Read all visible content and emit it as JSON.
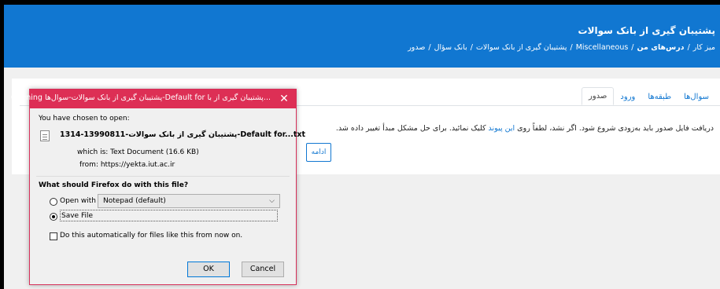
{
  "header": {
    "title": "پشتیبان گیری از بانک سوالات",
    "breadcrumb": [
      "میز کار",
      "درس‌های من",
      "Miscellaneous",
      "پشتیبان گیری از بانک سوالات",
      "بانک سؤال",
      "صدور"
    ]
  },
  "tabs": [
    {
      "label": "سوال‌ها"
    },
    {
      "label": "طبقه‌ها"
    },
    {
      "label": "ورود"
    },
    {
      "label": "صدور"
    }
  ],
  "message": {
    "before": "دریافت فایل صدور باید به‌زودی شروع شود. اگر نشد، لطفاً روی",
    "link": "این پیوند",
    "after": "کلیک نمائید. برای حل مشکل مبدأ تغییر داده شد."
  },
  "continue_label": "ادامه",
  "dialog": {
    "title": "Opening پشتیبان گیری از بانک سوالات-سوال‌ها-Default for پشتیبان گیری از با...",
    "chosen_label": "You have chosen to open:",
    "file_name": "پشتیبان گیری از بانک سوالات-13990811-1314-Default for...txt",
    "which_is": "which is: Text Document (16.6 KB)",
    "from": "from: https://yekta.iut.ac.ir",
    "question": "What should Firefox do with this file?",
    "open_with_label": "Open with",
    "open_with_value": "Notepad (default)",
    "save_label": "Save File",
    "save_selected": true,
    "auto_label": "Do this automatically for files like this from now on.",
    "ok_label": "OK",
    "cancel_label": "Cancel"
  },
  "colors": {
    "header": "#1177d1",
    "dialog_titlebar": "#dd2f55",
    "link": "#1177d1"
  },
  "icons": [
    "close-icon",
    "text-file-icon",
    "chevron-down-icon"
  ]
}
